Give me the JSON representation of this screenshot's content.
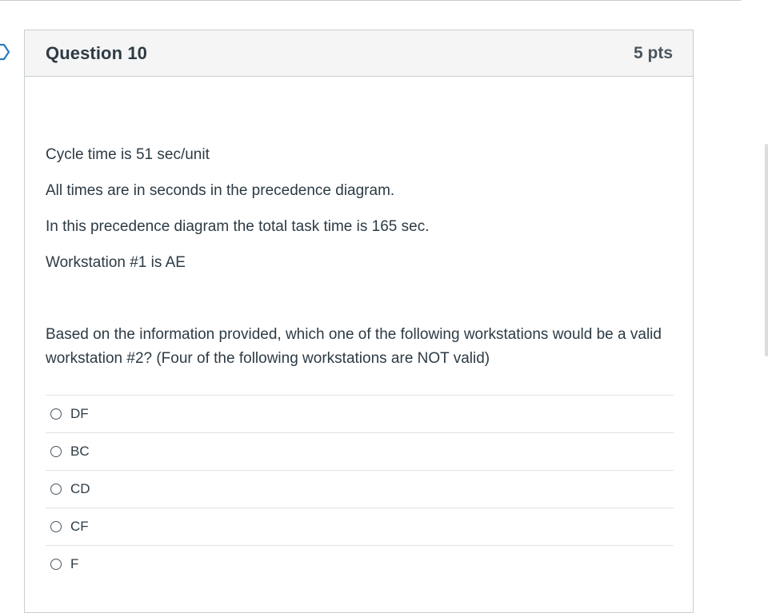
{
  "question": {
    "title": "Question 10",
    "points": "5 pts",
    "paragraphs": [
      "Cycle time is 51 sec/unit",
      "All times are in seconds in the precedence diagram.",
      "In this precedence diagram the total task time is 165 sec.",
      "Workstation #1 is AE",
      "Based on the information provided, which one of the following workstations would be a valid workstation #2? (Four of the following workstations are NOT valid)"
    ],
    "answers": [
      {
        "label": "DF",
        "selected": false
      },
      {
        "label": "BC",
        "selected": false
      },
      {
        "label": "CD",
        "selected": false
      },
      {
        "label": "CF",
        "selected": false
      },
      {
        "label": "F",
        "selected": false
      }
    ]
  },
  "colors": {
    "text": "#2d3b45",
    "header_background": "#f5f5f5",
    "border": "#c7cdd1",
    "flag_outline": "#2b7abc"
  },
  "icons": {
    "flag": "bookmark-flag-icon",
    "radio": "radio-unchecked-icon"
  }
}
